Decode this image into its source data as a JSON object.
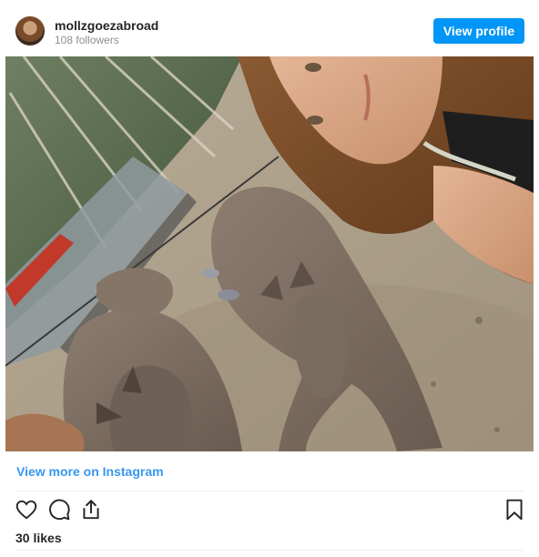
{
  "header": {
    "username": "mollzgoezabroad",
    "followers": "108 followers",
    "view_profile_label": "View profile"
  },
  "photo": {
    "description_icon": "photo-kangaroos-selfie"
  },
  "links": {
    "view_more_label": "View more on Instagram"
  },
  "actions": {
    "icons": [
      "heart-icon",
      "comment-icon",
      "share-icon",
      "bookmark-icon"
    ]
  },
  "stats": {
    "likes_label": "30 likes"
  },
  "colors": {
    "accent": "#0095f6",
    "link": "#3897f0",
    "text": "#262626",
    "muted": "#8e8e8e"
  }
}
